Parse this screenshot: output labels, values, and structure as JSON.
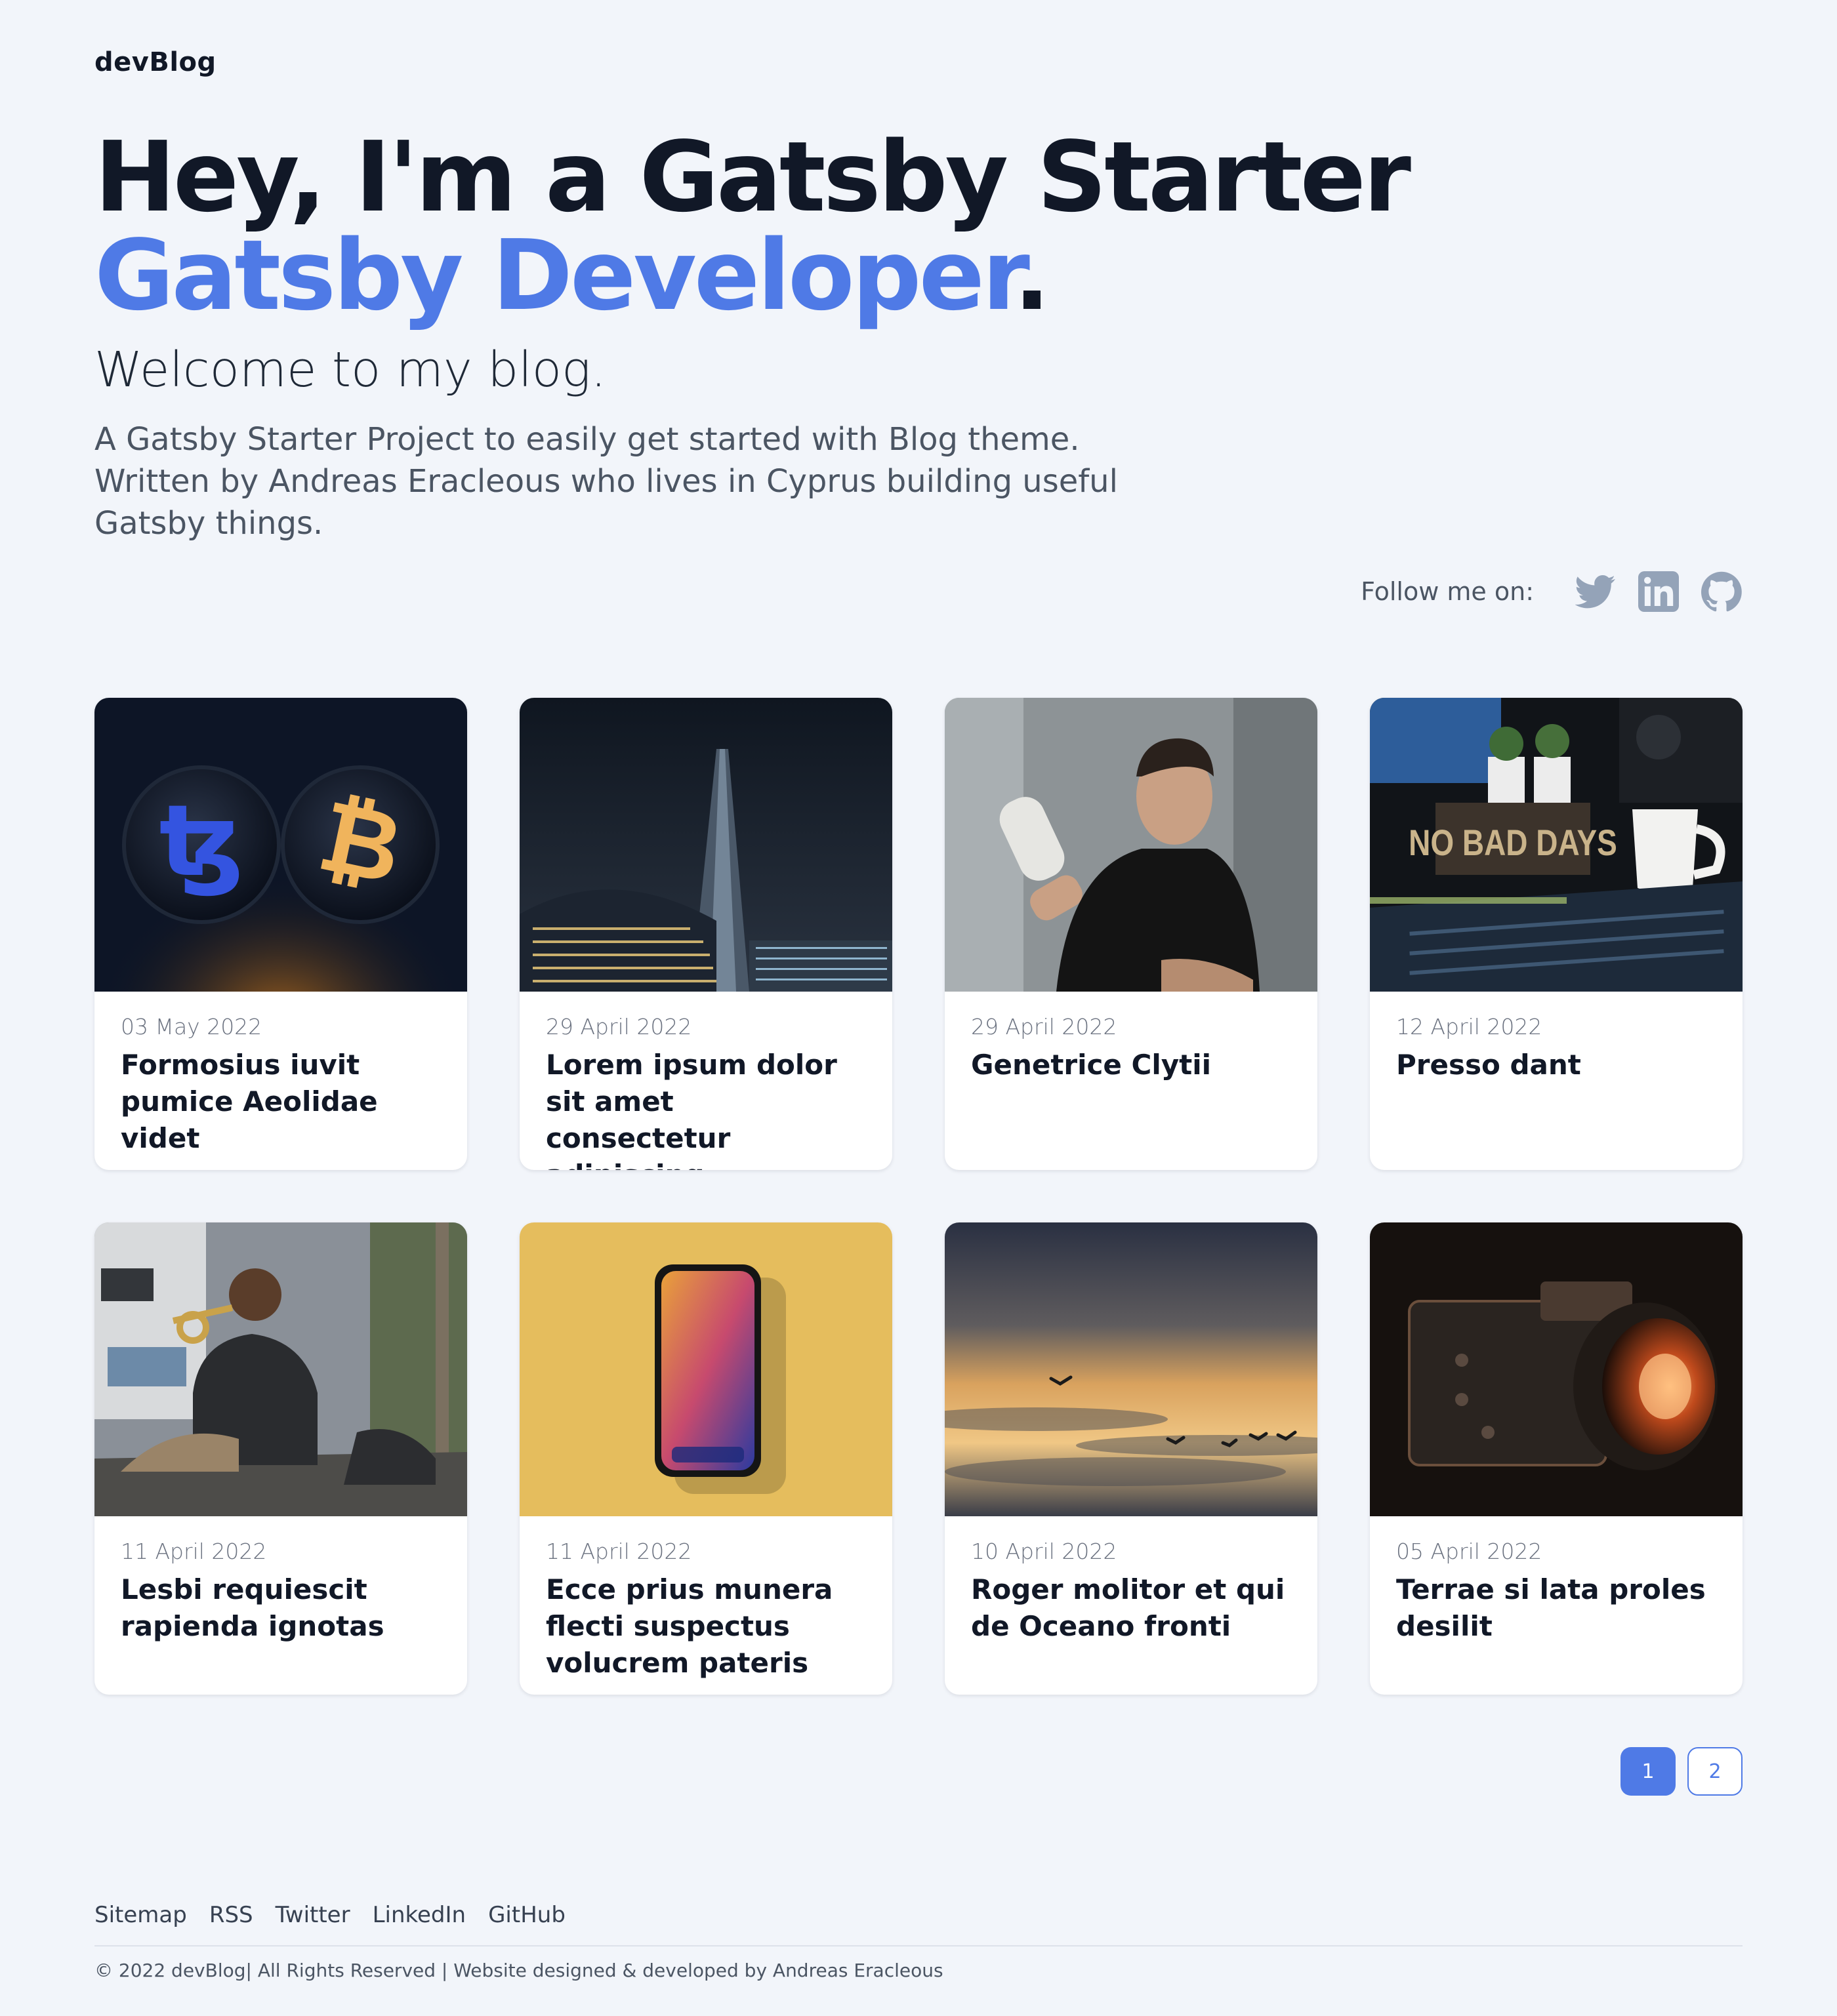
{
  "brand": {
    "name": "devBlog"
  },
  "hero": {
    "line1": "Hey, I'm a Gatsby Starter",
    "line2": "Gatsby Developer",
    "line2_suffix": ".",
    "welcome": "Welcome to my blog.",
    "description": "A Gatsby Starter Project to easily get started with Blog theme. Written by Andreas Eracleous who lives in Cyprus building useful Gatsby things."
  },
  "social": {
    "label": "Follow me on:",
    "icons": [
      "twitter-icon",
      "linkedin-icon",
      "github-icon"
    ]
  },
  "posts": [
    {
      "date": "03 May 2022",
      "title": "Formosius iuvit pumice Aeolidae videt"
    },
    {
      "date": "29 April 2022",
      "title": "Lorem ipsum dolor sit amet consectetur adipiscing"
    },
    {
      "date": "29 April 2022",
      "title": "Genetrice Clytii"
    },
    {
      "date": "12 April 2022",
      "title": "Presso dant"
    },
    {
      "date": "11 April 2022",
      "title": "Lesbi requiescit rapienda ignotas"
    },
    {
      "date": "11 April 2022",
      "title": "Ecce prius munera flecti suspectus volucrem pateris"
    },
    {
      "date": "10 April 2022",
      "title": "Roger molitor et qui de Oceano fronti"
    },
    {
      "date": "05 April 2022",
      "title": "Terrae si lata proles desilit"
    }
  ],
  "photo_texts": {
    "no_bad_days": "NO BAD DAYS"
  },
  "pagination": {
    "pages": [
      "1",
      "2"
    ],
    "current": "1"
  },
  "footer": {
    "links": [
      "Sitemap",
      "RSS",
      "Twitter",
      "LinkedIn",
      "GitHub"
    ],
    "copyright": "© 2022 devBlog| All Rights Reserved | Website designed & developed by Andreas Eracleous"
  },
  "colors": {
    "accent": "#4f7ae6",
    "background": "#f2f5fa",
    "heading": "#111827",
    "icon": "#94a3b8"
  }
}
